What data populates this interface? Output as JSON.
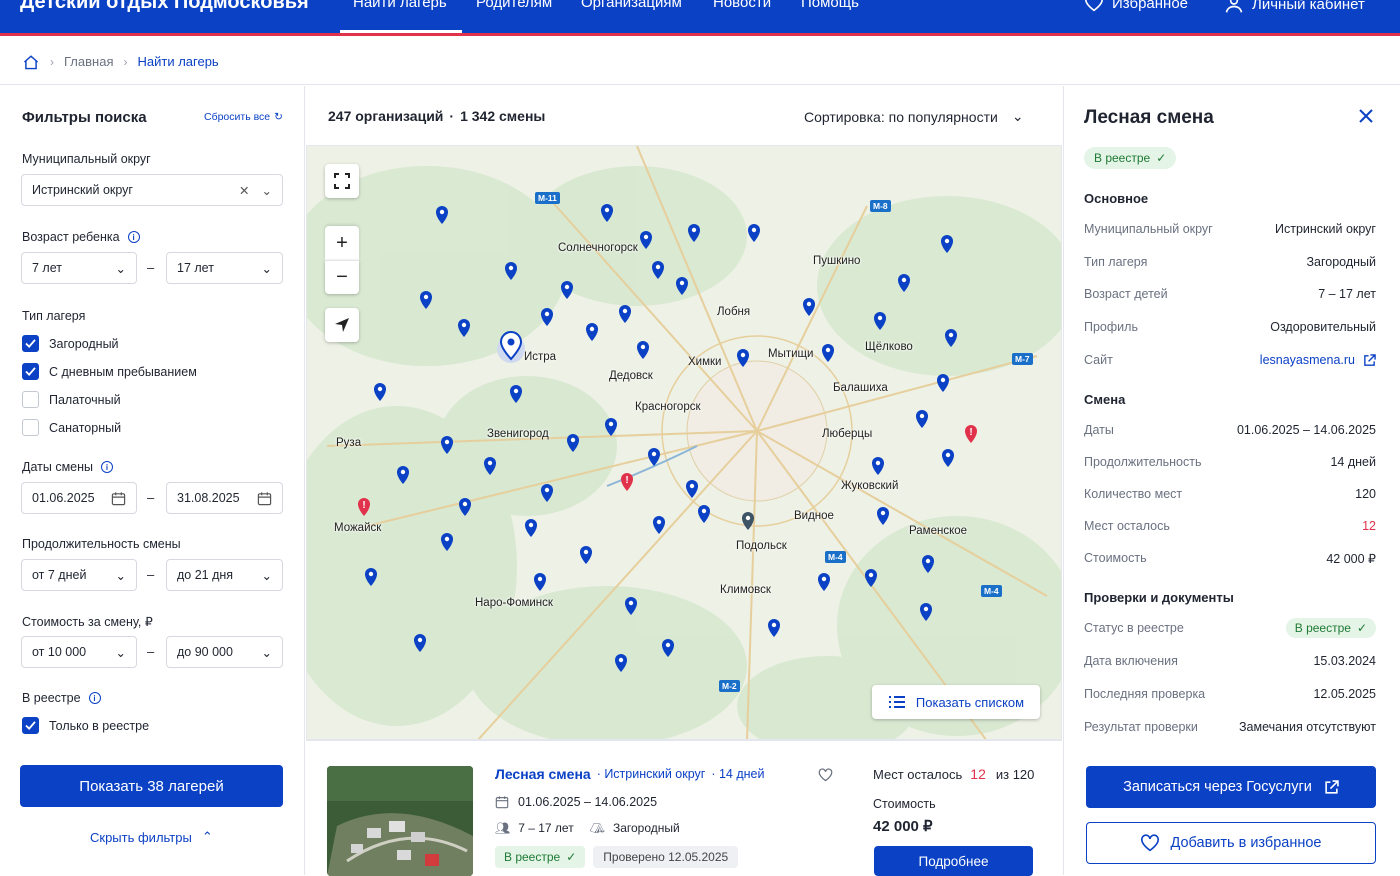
{
  "topbar": {
    "brand": "Детский отдых Подмосковья",
    "nav": [
      "Найти лагерь",
      "Родителям",
      "Организациям",
      "Новости",
      "Помощь"
    ],
    "favorites": "Избранное",
    "account": "Личный кабинет"
  },
  "breadcrumbs": {
    "home": "Главная",
    "current": "Найти лагерь"
  },
  "filters": {
    "title": "Фильтры поиска",
    "reset": "Сбросить все",
    "district_label": "Муниципальный округ",
    "district_value": "Истринский округ",
    "age_label": "Возраст ребенка",
    "age_from": "7 лет",
    "age_to": "17 лет",
    "camp_type_label": "Тип лагеря",
    "camp_types": [
      {
        "label": "Загородный",
        "checked": true
      },
      {
        "label": "С дневным пребыванием",
        "checked": true
      },
      {
        "label": "Палаточный",
        "checked": false
      },
      {
        "label": "Санаторный",
        "checked": false
      }
    ],
    "dates_label": "Даты смены",
    "date_from": "01.06.2025",
    "date_to": "31.08.2025",
    "duration_label": "Продолжительность смены",
    "duration_from": "от 7 дней",
    "duration_to": "до 21 дня",
    "cost_label": "Стоимость за смену, ₽",
    "cost_from": "от 10 000",
    "cost_to": "до 90 000",
    "registry_label": "В реестре",
    "registry_only": "Только в реестре",
    "show_button": "Показать 38 лагерей",
    "hide_filters": "Скрыть фильтры"
  },
  "results": {
    "count_orgs": "247 организаций",
    "count_sep": "·",
    "count_shifts": "1 342 смены",
    "sort": "Сортировка: по популярности",
    "show_list": "Показать списком"
  },
  "map": {
    "cities": [
      "Солнечногорск",
      "Пушкино",
      "Лобня",
      "Истра",
      "Дедовск",
      "Химки",
      "Мытищи",
      "Щёлково",
      "Балашиха",
      "Красногорск",
      "Руза",
      "Звенигород",
      "Люберцы",
      "Жуковский",
      "Можайск",
      "Видное",
      "Подольск",
      "Раменское",
      "Климовск",
      "Наро-Фоминск"
    ],
    "highways": [
      "М-11",
      "М-8",
      "М-7",
      "М-4",
      "М-4",
      "М-2"
    ]
  },
  "card": {
    "name": "Лесная смена",
    "district": "· Истринский округ",
    "duration": "· 14 дней",
    "dates": "01.06.2025 – 14.06.2025",
    "age": "7 – 17 лет",
    "type": "Загородный",
    "registry_badge": "В реестре",
    "checked": "Проверено 12.05.2025",
    "places_label": "Мест осталось",
    "places_left": "12",
    "places_of": "из 120",
    "cost_label": "Стоимость",
    "cost": "42 000 ₽",
    "details_button": "Подробнее"
  },
  "detail": {
    "title": "Лесная смена",
    "badge": "В реестре",
    "main_title": "Основное",
    "main_rows": [
      {
        "k": "Муниципальный округ",
        "v": "Истринский округ"
      },
      {
        "k": "Тип лагеря",
        "v": "Загородный"
      },
      {
        "k": "Возраст детей",
        "v": "7 – 17 лет"
      },
      {
        "k": "Профиль",
        "v": "Оздоровительный"
      }
    ],
    "site_label": "Сайт",
    "site_value": "lesnayasmena.ru",
    "shift_title": "Смена",
    "shift_rows": [
      {
        "k": "Даты",
        "v": "01.06.2025 – 14.06.2025"
      },
      {
        "k": "Продолжительность",
        "v": "14 дней"
      },
      {
        "k": "Количество мест",
        "v": "120"
      }
    ],
    "places_left_label": "Мест осталось",
    "places_left_value": "12",
    "cost_label": "Стоимость",
    "cost_value": "42 000 ₽",
    "checks_title": "Проверки и документы",
    "status_label": "Статус в реестре",
    "status_value": "В реестре",
    "check_rows": [
      {
        "k": "Дата включения",
        "v": "15.03.2024"
      },
      {
        "k": "Последняя проверка",
        "v": "12.05.2025"
      },
      {
        "k": "Результат проверки",
        "v": "Замечания отсутствуют"
      }
    ],
    "enroll_button": "Записаться через Госуслуги",
    "favorite_button": "Добавить в избранное"
  },
  "colors": {
    "brand": "#0b41c5",
    "accent_red": "#e0324a",
    "success": "#1e7a34"
  }
}
